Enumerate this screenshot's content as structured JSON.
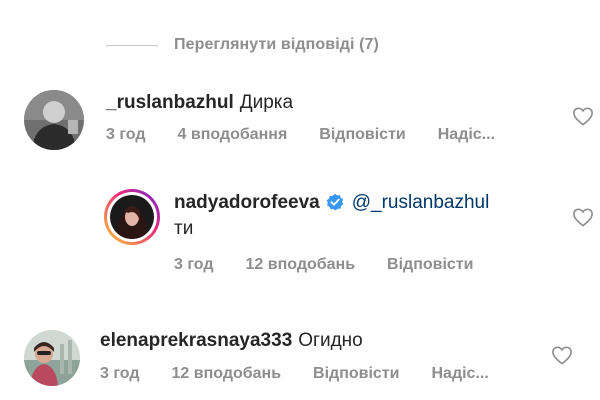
{
  "view_replies": {
    "label": "Переглянути відповіді (7)"
  },
  "comments": [
    {
      "username": "_ruslanbazhul",
      "text": "Дирка",
      "time": "3 год",
      "likes": "4 вподобання",
      "reply": "Відповісти",
      "more": "Надіс..."
    },
    {
      "username": "nadyadorofeeva",
      "mention": "@_ruslanbazhul",
      "text": "ти",
      "time": "3 год",
      "likes": "12 вподобань",
      "reply": "Відповісти"
    },
    {
      "username": "elenaprekrasnaya333",
      "text": "Огидно",
      "time": "3 год",
      "likes": "12 вподобань",
      "reply": "Відповісти",
      "more": "Надіс..."
    }
  ],
  "colors": {
    "secondary_text": "#8e8e8e",
    "mention": "#00376b",
    "verified": "#3897f0",
    "story_ring_start": "#f9ce34",
    "story_ring_end": "#ee2a7b"
  },
  "icons": [
    "heart-icon",
    "verified-badge-icon"
  ]
}
